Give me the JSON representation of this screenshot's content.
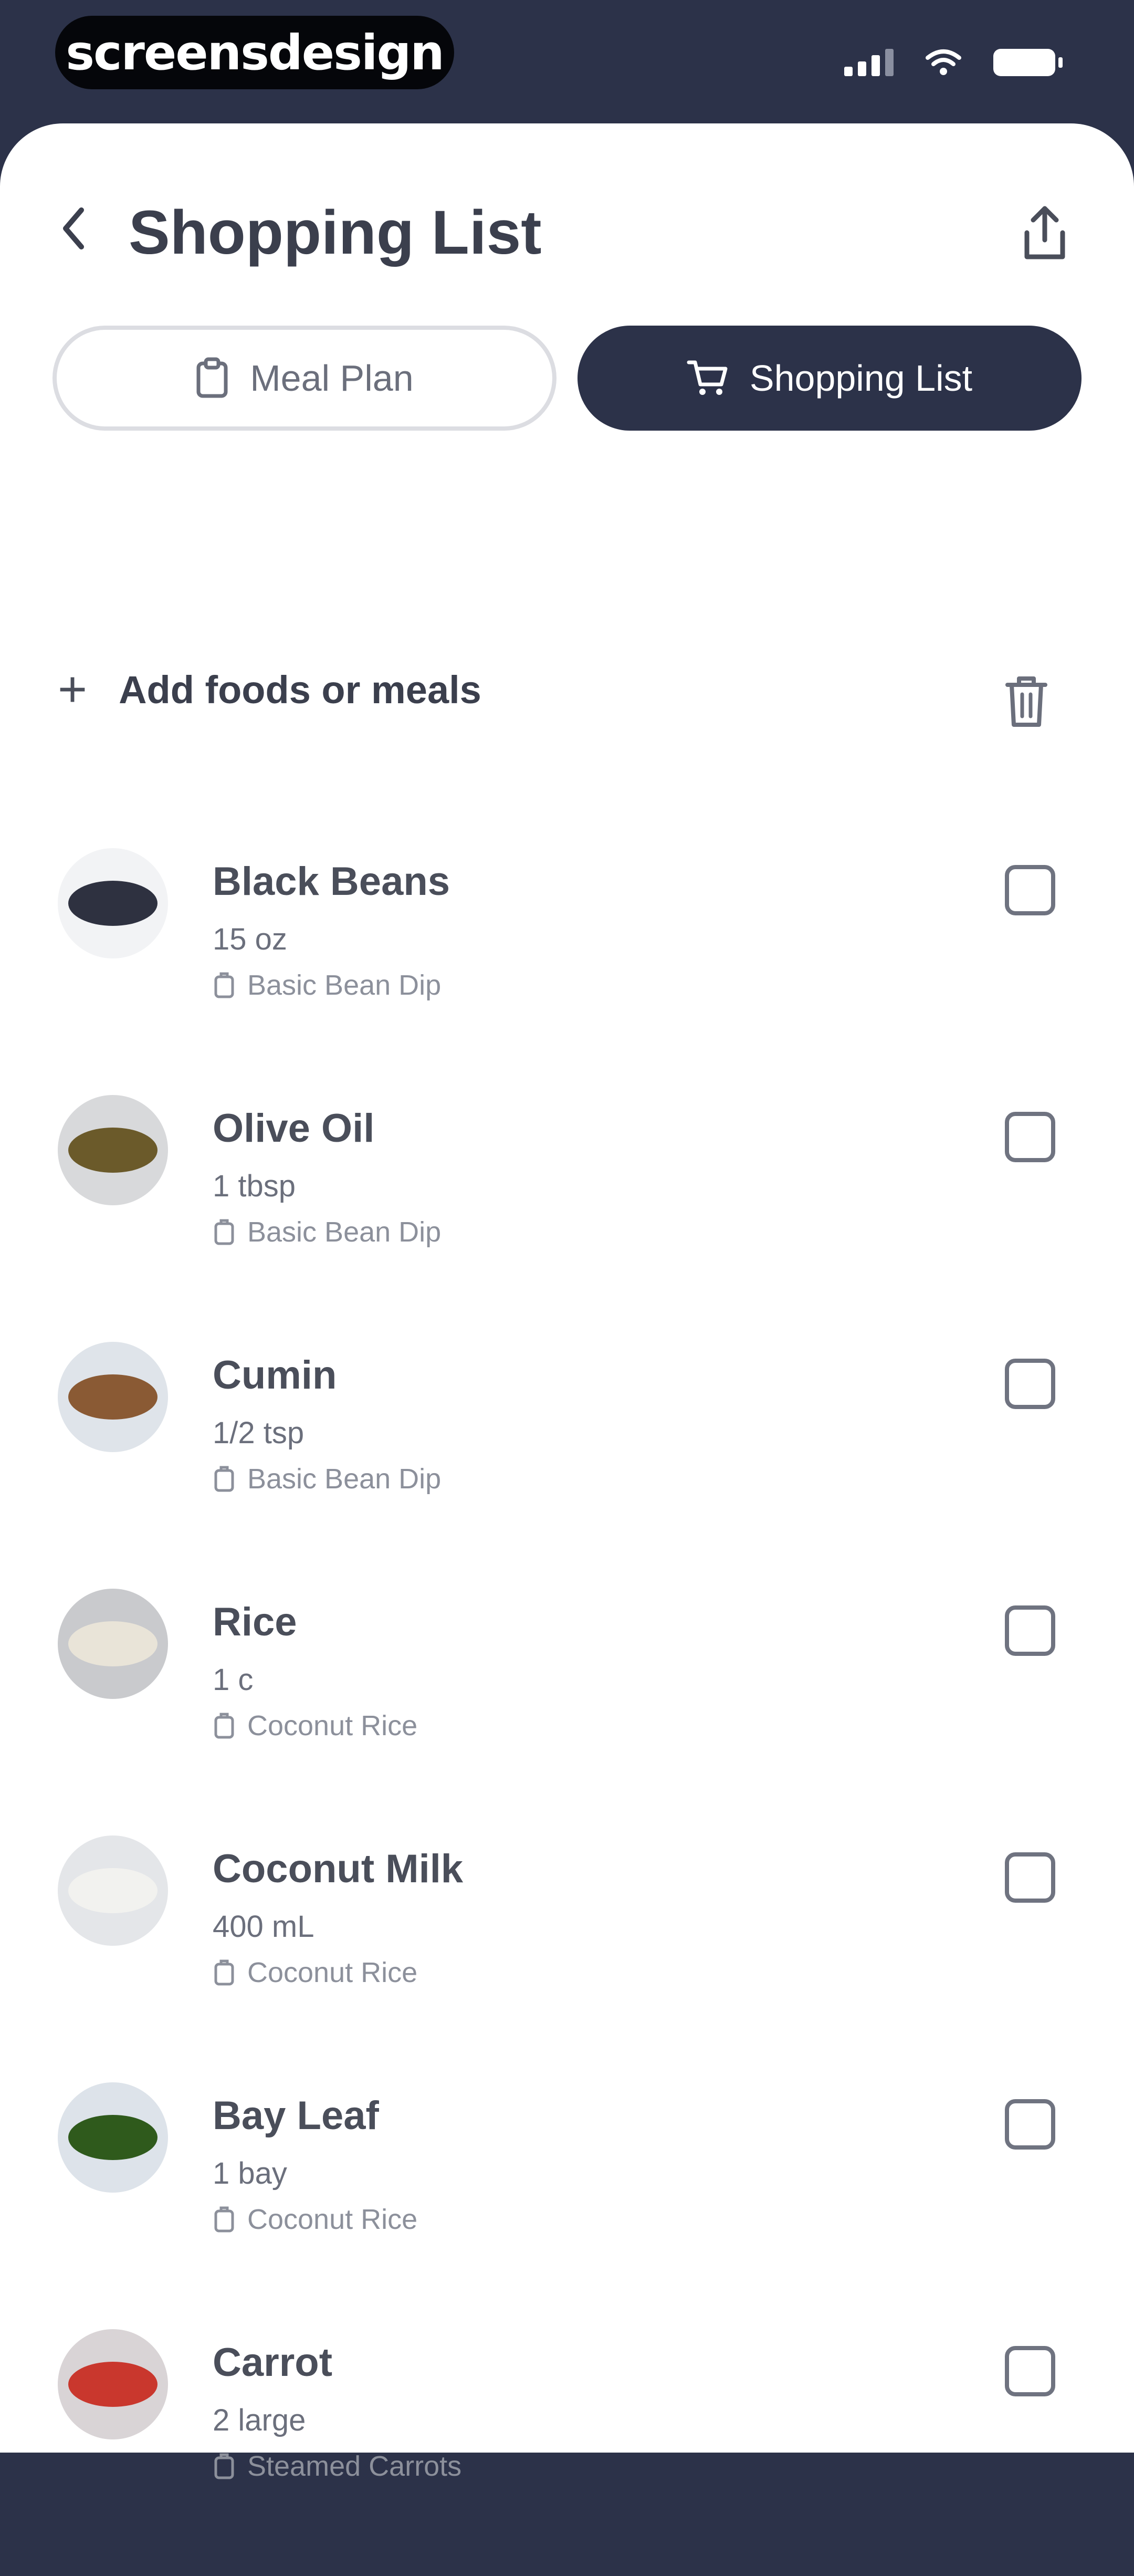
{
  "status_bar": {
    "brand": "screensdesign"
  },
  "header": {
    "title": "Shopping List"
  },
  "tabs": [
    {
      "label": "Meal Plan",
      "icon": "clipboard-icon",
      "active": false
    },
    {
      "label": "Shopping List",
      "icon": "cart-icon",
      "active": true
    }
  ],
  "add": {
    "label": "Add foods or meals"
  },
  "items": [
    {
      "name": "Black Beans",
      "qty": "15 oz",
      "recipe": "Basic Bean Dip",
      "color": "#2e3140",
      "bg": "#f2f3f5"
    },
    {
      "name": "Olive Oil",
      "qty": "1 tbsp",
      "recipe": "Basic Bean Dip",
      "color": "#6b5a2a",
      "bg": "#d8d9db"
    },
    {
      "name": "Cumin",
      "qty": "1/2 tsp",
      "recipe": "Basic Bean Dip",
      "color": "#8a5a34",
      "bg": "#dfe4ea"
    },
    {
      "name": "Rice",
      "qty": "1 c",
      "recipe": "Coconut Rice",
      "color": "#e9e4d8",
      "bg": "#c9cacd"
    },
    {
      "name": "Coconut Milk",
      "qty": "400 mL",
      "recipe": "Coconut Rice",
      "color": "#f2f2ef",
      "bg": "#e4e6e9"
    },
    {
      "name": "Bay Leaf",
      "qty": "1 bay",
      "recipe": "Coconut Rice",
      "color": "#2f5a1c",
      "bg": "#dde3ea"
    },
    {
      "name": "Carrot",
      "qty": "2 large",
      "recipe": "Steamed Carrots",
      "color": "#c9372d",
      "bg": "#d9d4d6"
    }
  ],
  "colors": {
    "navy": "#2c3249",
    "text": "#3b3f4d",
    "muted": "#8c909b"
  }
}
